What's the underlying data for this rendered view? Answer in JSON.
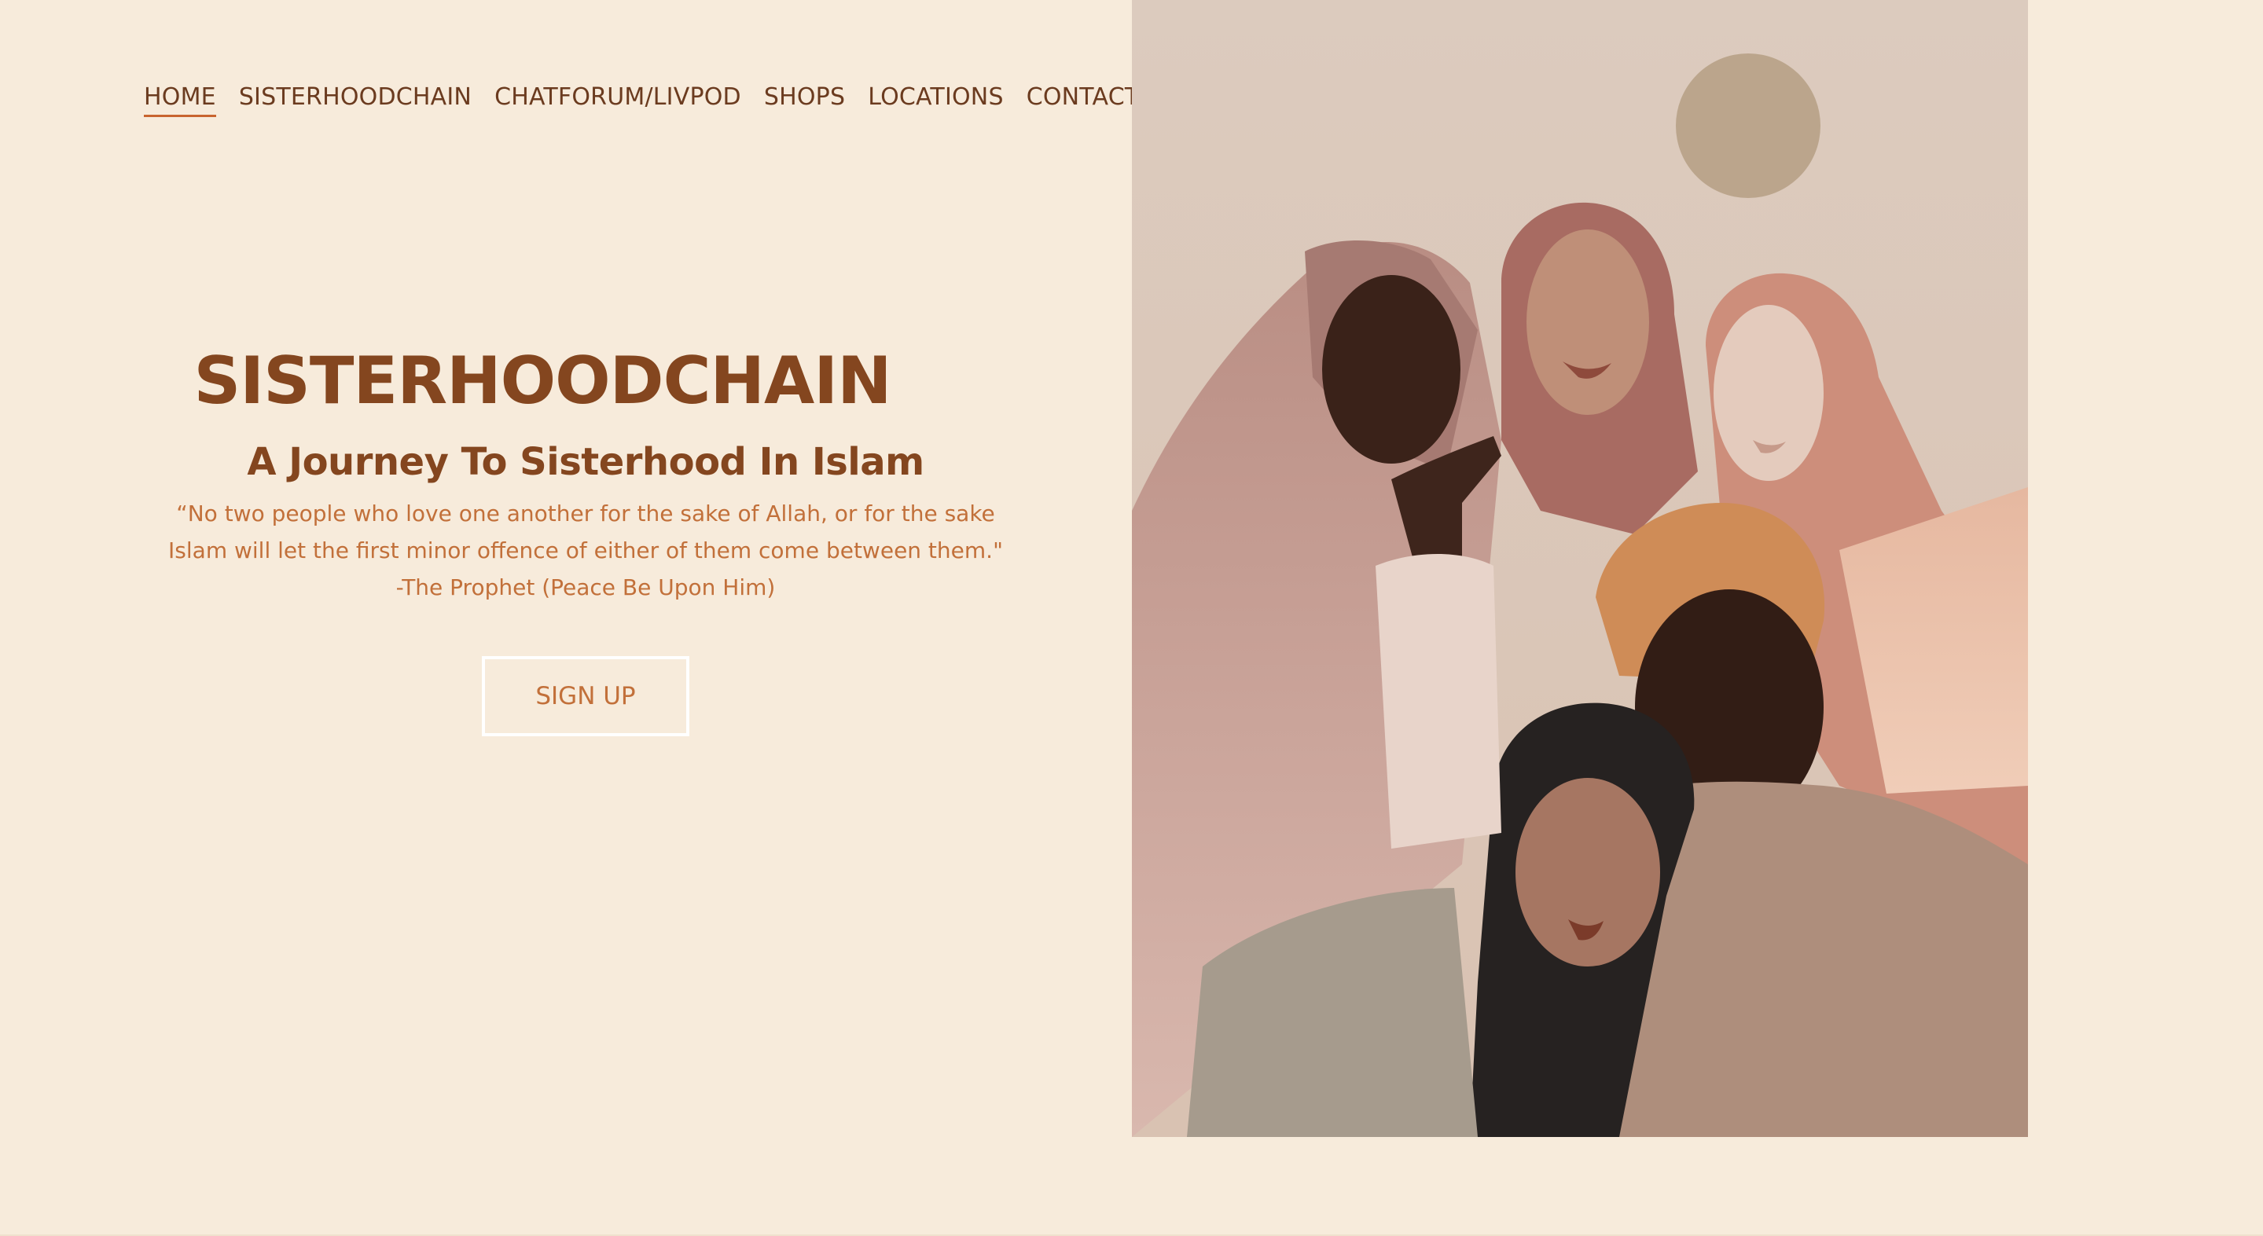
{
  "nav": {
    "items": [
      {
        "label": "HOME",
        "active": true
      },
      {
        "label": "SISTERHOODCHAIN"
      },
      {
        "label": "CHATFORUM/LIVPOD"
      },
      {
        "label": "SHOPS"
      },
      {
        "label": "LOCATIONS"
      },
      {
        "label": "CONTACT"
      }
    ]
  },
  "hero": {
    "title": "SISTERHOODCHAIN",
    "subtitle": "A Journey To Sisterhood In Islam",
    "quote_line1": "“No two people who love one another for the sake of Allah, or for the sake",
    "quote_line2": "Islam will let the first minor offence of either of them come between them.\"",
    "quote_line3": "-The Prophet (Peace Be Upon Him)",
    "button_label": "SIGN UP"
  },
  "colors": {
    "background": "#f7ebdb",
    "heading": "#84461f",
    "accent": "#c2703a",
    "nav_text": "#6b3b1f",
    "nav_underline": "#c8642f"
  }
}
